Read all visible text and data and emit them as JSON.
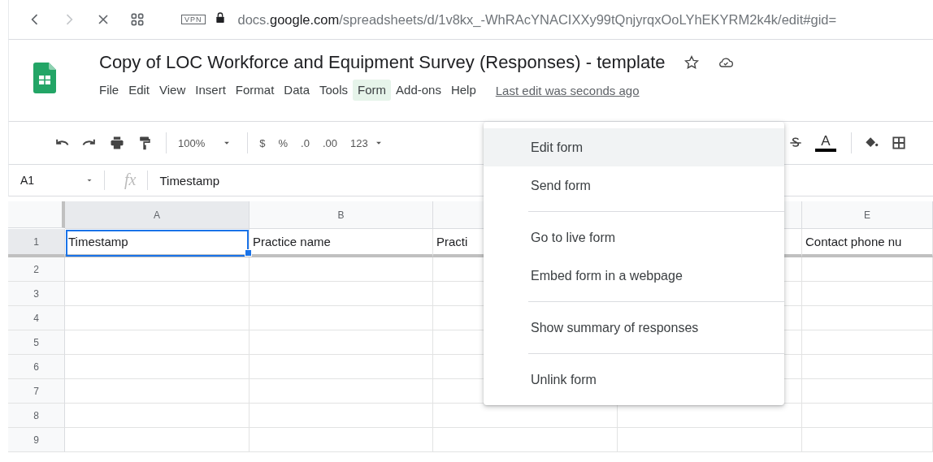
{
  "browser": {
    "vpn_badge": "VPN",
    "address_prefix": "docs.",
    "address_host": "google.com",
    "address_path": "/spreadsheets/d/1v8kx_-WhRAcYNACIXXy99tQnjyrqxOoLYhEKYRM2k4k/edit#gid="
  },
  "document": {
    "title": "Copy of LOC Workforce and Equipment Survey (Responses) - template"
  },
  "menu_bar": [
    {
      "label": "File",
      "selected": false
    },
    {
      "label": "Edit",
      "selected": false
    },
    {
      "label": "View",
      "selected": false
    },
    {
      "label": "Insert",
      "selected": false
    },
    {
      "label": "Format",
      "selected": false
    },
    {
      "label": "Data",
      "selected": false
    },
    {
      "label": "Tools",
      "selected": false
    },
    {
      "label": "Form",
      "selected": true
    },
    {
      "label": "Add-ons",
      "selected": false
    },
    {
      "label": "Help",
      "selected": false
    }
  ],
  "last_edit": "Last edit was seconds ago",
  "toolbar": {
    "zoom": "100%",
    "currency": "$",
    "percent": "%",
    "decrease_decimals": ".0",
    "increase_decimals": ".00",
    "more_formats": "123",
    "text_color": "A"
  },
  "formula_bar": {
    "cell_reference": "A1",
    "fx": "fx",
    "value": "Timestamp"
  },
  "sheet": {
    "columns": [
      {
        "label": "A",
        "selected": true
      },
      {
        "label": "B",
        "selected": false
      },
      {
        "selected": false
      },
      {
        "selected": false
      },
      {
        "label": "E",
        "selected": false
      }
    ],
    "rows": [
      {
        "number": "1",
        "selected": true,
        "cells": [
          {
            "text": "Timestamp",
            "selected": true
          },
          {
            "text": "Practice name",
            "selected": false
          },
          {
            "text": "Practi",
            "selected": false
          },
          {
            "selected": false
          },
          {
            "text": "Contact phone nu",
            "selected": false
          }
        ]
      },
      {
        "number": "2",
        "selected": false
      },
      {
        "number": "3",
        "selected": false
      },
      {
        "number": "4",
        "selected": false
      },
      {
        "number": "5",
        "selected": false
      },
      {
        "number": "6",
        "selected": false
      },
      {
        "number": "7",
        "selected": false
      },
      {
        "number": "8",
        "selected": false
      },
      {
        "number": "9",
        "selected": false
      }
    ]
  },
  "form_menu": [
    {
      "items": [
        {
          "label": "Edit form",
          "selected": true
        },
        {
          "label": "Send form",
          "selected": false
        }
      ]
    },
    {
      "items": [
        {
          "label": "Go to live form",
          "selected": false
        },
        {
          "label": "Embed form in a webpage",
          "selected": false
        }
      ]
    },
    {
      "items": [
        {
          "label": "Show summary of responses",
          "selected": false
        }
      ]
    },
    {
      "items": [
        {
          "label": "Unlink form",
          "selected": false
        }
      ]
    }
  ]
}
